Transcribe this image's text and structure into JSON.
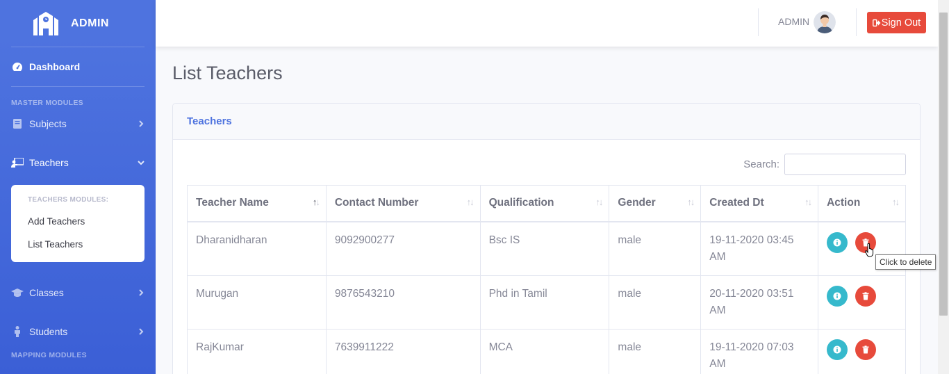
{
  "brand": {
    "name": "ADMIN",
    "icon": "school-building-icon"
  },
  "sidebar": {
    "dashboard": "Dashboard",
    "master_heading": "MASTER MODULES",
    "subjects": "Subjects",
    "teachers": "Teachers",
    "teachers_sub": {
      "heading": "TEACHERS MODULES:",
      "items": [
        "Add Teachers",
        "List Teachers"
      ]
    },
    "classes": "Classes",
    "students": "Students",
    "mapping_heading": "MAPPING MODULES"
  },
  "topbar": {
    "user_name": "ADMIN",
    "signout_label": "Sign Out"
  },
  "page": {
    "title": "List Teachers"
  },
  "card": {
    "title": "Teachers",
    "search_label": "Search:",
    "search_value": "",
    "columns": [
      "Teacher Name",
      "Contact Number",
      "Qualification",
      "Gender",
      "Created Dt",
      "Action"
    ],
    "rows": [
      {
        "name": "Dharanidharan",
        "contact": "9092900277",
        "qualification": "Bsc IS",
        "gender": "male",
        "created": "19-11-2020 03:45 AM"
      },
      {
        "name": "Murugan",
        "contact": "9876543210",
        "qualification": "Phd in Tamil",
        "gender": "male",
        "created": "20-11-2020 03:51 AM"
      },
      {
        "name": "RajKumar",
        "contact": "7639911222",
        "qualification": "MCA",
        "gender": "male",
        "created": "19-11-2020 07:03 AM"
      }
    ]
  },
  "tooltip": "Click to delete",
  "colors": {
    "primary": "#4e73df",
    "danger": "#e74a3b",
    "info": "#36b9cc"
  }
}
